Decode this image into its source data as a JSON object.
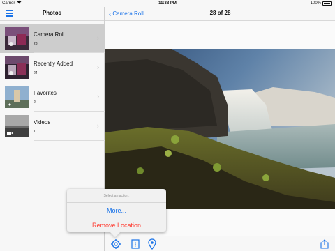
{
  "status_bar": {
    "carrier": "Carrier",
    "time": "11:38 PM",
    "battery": "100%"
  },
  "sidebar": {
    "title": "Photos",
    "albums": [
      {
        "name": "Camera Roll",
        "count": "28",
        "selected": true
      },
      {
        "name": "Recently Added",
        "count": "24",
        "selected": false
      },
      {
        "name": "Favorites",
        "count": "2",
        "selected": false
      },
      {
        "name": "Videos",
        "count": "1",
        "selected": false
      }
    ]
  },
  "nav": {
    "back_label": "Camera Roll",
    "title": "28 of 28"
  },
  "action_sheet": {
    "heading": "Select an action:",
    "actions": [
      "More...",
      "Remove Location"
    ]
  },
  "toolbar": {
    "icons": [
      "gear-icon",
      "info-icon",
      "location-pin-icon",
      "share-icon"
    ]
  },
  "colors": {
    "accent": "#1a73e8",
    "destructive": "#ff3b30",
    "selected_row": "#cdcdcd"
  }
}
